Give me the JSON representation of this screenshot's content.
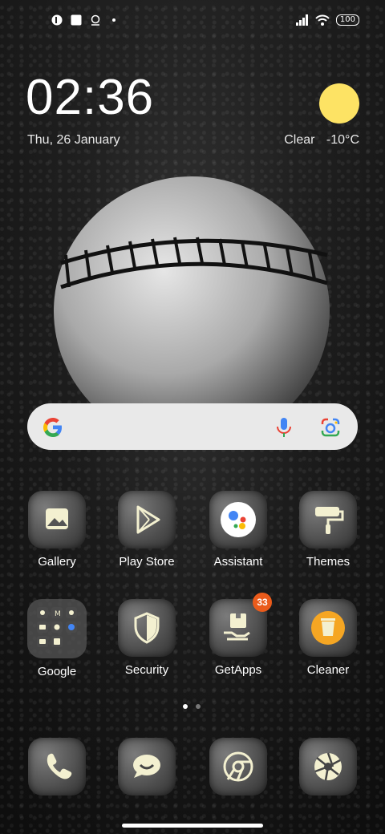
{
  "status_bar": {
    "battery": "100",
    "icons": [
      "notification-icon",
      "square-icon",
      "location-icon",
      "signal-icon",
      "wifi-icon"
    ]
  },
  "lock_widget": {
    "time": "02:36",
    "date": "Thu, 26 January",
    "weather": {
      "condition": "Clear",
      "temperature": "-10°C",
      "icon": "sun-icon",
      "color": "#fde364"
    }
  },
  "search_bar": {
    "left_icon": "google-icon",
    "mic_icon": "microphone-icon",
    "lens_icon": "google-lens-icon"
  },
  "apps": [
    {
      "label": "Gallery"
    },
    {
      "label": "Play Store"
    },
    {
      "label": "Assistant"
    },
    {
      "label": "Themes"
    },
    {
      "label": "Google"
    },
    {
      "label": "Security"
    },
    {
      "label": "GetApps",
      "badge": "33"
    },
    {
      "label": "Cleaner"
    }
  ],
  "dock": [
    {
      "name": "Phone",
      "icon": "phone-icon"
    },
    {
      "name": "Messaging",
      "icon": "chat-icon"
    },
    {
      "name": "Chrome",
      "icon": "chrome-icon"
    },
    {
      "name": "Camera",
      "icon": "camera-aperture-icon"
    }
  ],
  "colors": {
    "badge": "#ea5b1b",
    "icon_glyph": "#f3f0d0"
  }
}
